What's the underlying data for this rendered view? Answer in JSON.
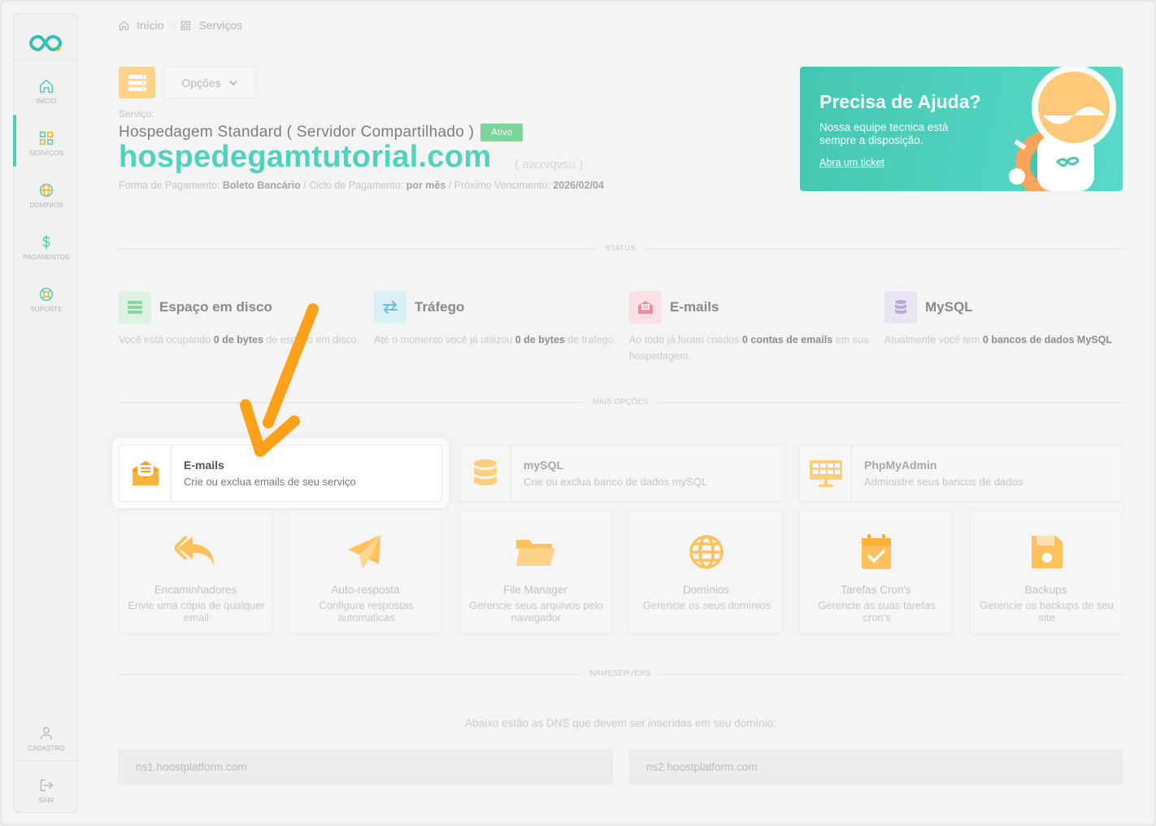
{
  "sidebar": {
    "logo": "infinity-logo",
    "items": [
      {
        "label": "INÍCIO",
        "icon": "home-icon"
      },
      {
        "label": "SERVIÇOS",
        "icon": "grid-icon",
        "active": true
      },
      {
        "label": "DOMÍNIOS",
        "icon": "globe-icon"
      },
      {
        "label": "PAGAMENTOS",
        "icon": "dollar-icon"
      },
      {
        "label": "SUPORTE",
        "icon": "lifebuoy-icon"
      }
    ],
    "bottom": [
      {
        "label": "CADASTRO",
        "icon": "user-icon"
      },
      {
        "label": "SAIR",
        "icon": "logout-icon"
      }
    ]
  },
  "breadcrumb": {
    "home": "Início",
    "sep": "·",
    "current": "Serviços"
  },
  "header": {
    "options_label": "Opções",
    "caption": "Serviço:",
    "plan": "Hospedagem Standard ( Servidor Compartilhado )",
    "status_badge": "Ativo",
    "domain": "hospedegamtutorial.com",
    "username": "( awxvqvsu )",
    "payment": {
      "form_label": "Forma de Pagamento:",
      "form_value": "Boleto Bancário",
      "cycle_label": " / Ciclo de Pagamento:",
      "cycle_value": "por mês",
      "due_label": " / Próximo Vencimento:",
      "due_value": "2026/02/04"
    }
  },
  "help": {
    "title": "Precisa de Ajuda?",
    "text": "Nossa equipe tecnica está sempre a disposição.",
    "link": "Abra um ticket"
  },
  "sections": {
    "status": "STATUS",
    "more": "MAIS OPÇÕES",
    "nameservers": "NAMESERVERS"
  },
  "status": [
    {
      "title": "Espaço em disco",
      "pre": "Você está ocupando ",
      "value": "0 de bytes",
      "post": " de espaço em disco.",
      "icon": "server-icon",
      "color": "#cfeed8"
    },
    {
      "title": "Tráfego",
      "pre": "Até o momento você já utilizou ",
      "value": "0 de bytes",
      "post": " de trafego.",
      "icon": "transfer-icon",
      "color": "#d2ecf5"
    },
    {
      "title": "E-mails",
      "pre": "Ao todo já foram criados ",
      "value": "0 contas de emails",
      "post": " em sua hospedagem.",
      "icon": "mail-icon",
      "color": "#f8d9df"
    },
    {
      "title": "MySQL",
      "pre": "Atualmente você tem ",
      "value": "0 bancos de dados MySQL",
      "post": "",
      "icon": "database-icon",
      "color": "#e4e0ef"
    }
  ],
  "options": [
    {
      "title": "E-mails",
      "sub": "Crie ou exclua emails de seu serviço",
      "icon": "email-icon"
    },
    {
      "title": "mySQL",
      "sub": "Crie ou exclua banco de dados mySQL",
      "icon": "database-icon"
    },
    {
      "title": "PhpMyAdmin",
      "sub": "Administre seus bancos de dados",
      "icon": "dashboard-icon"
    }
  ],
  "tiles": [
    {
      "title": "Encaminhadores",
      "sub": "Envie uma cópia de qualquer email",
      "icon": "forward-icon"
    },
    {
      "title": "Auto-resposta",
      "sub": "Configure respostas automaticas",
      "icon": "send-icon"
    },
    {
      "title": "File Manager",
      "sub": "Gerencie seus arquivos pelo navegador",
      "icon": "folder-icon"
    },
    {
      "title": "Domínios",
      "sub": "Gerencie os seus domínios",
      "icon": "globe-icon"
    },
    {
      "title": "Tarefas Cron's",
      "sub": "Gerencie as suas tarefas cron's",
      "icon": "calendar-check-icon"
    },
    {
      "title": "Backups",
      "sub": "Gerencie os backups de seu site",
      "icon": "floppy-icon"
    }
  ],
  "nameservers": {
    "caption": "Abaixo estão as DNS que devem ser inseridas em seu domínio:",
    "ns1": "ns1.hoostplatform.com",
    "ns2": "ns2.hoostplatform.com"
  },
  "colors": {
    "accent": "#4fd2be",
    "orange": "#ffb020",
    "badge": "#7ed29b"
  }
}
